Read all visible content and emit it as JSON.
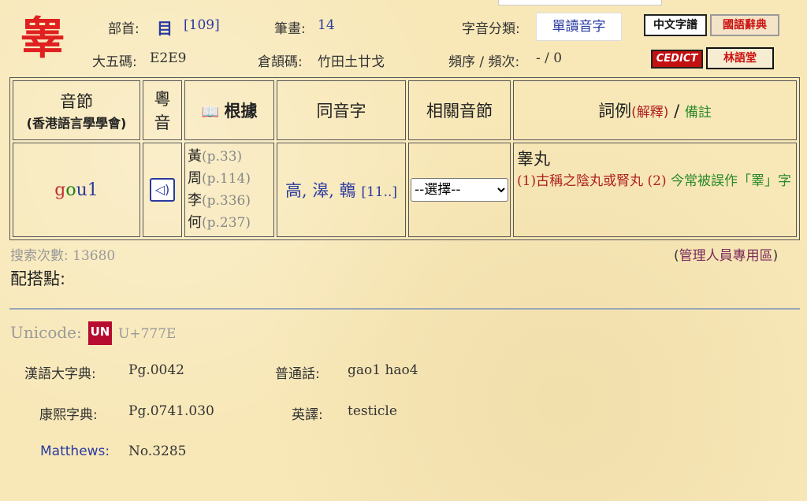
{
  "char": "睾",
  "header": {
    "radical_label": "部首:",
    "radical_icon": "目",
    "radical_num": "[109]",
    "strokes_label": "筆畫:",
    "strokes": "14",
    "class_label": "字音分類:",
    "class_value": "單讀音字",
    "big5_label": "大五碼:",
    "big5": "E2E9",
    "cangjie_label": "倉頡碼:",
    "cangjie": "竹田土廿戈",
    "freq_label": "頻序 / 頻次:",
    "freq": "- / 0",
    "logos": {
      "zhongwen": "中文字譜",
      "guoyu": "國語辭典",
      "cedict": "CEDICT",
      "linyutang": "林語堂"
    }
  },
  "table": {
    "headers": {
      "syllable": "音節",
      "syllable_sub": "(香港語言學學會)",
      "cantonese_1": "粵",
      "cantonese_2": "音",
      "basis_icon": "📖",
      "basis": "根據",
      "homophones": "同音字",
      "related": "相關音節",
      "examples": "詞例",
      "explain": "(解釋)",
      "slash": " / ",
      "notes": "備註"
    },
    "row": {
      "syllable_g": "g",
      "syllable_o": "o",
      "syllable_u1": "u1",
      "refs": [
        {
          "char": "黃",
          "page": "(p.33)"
        },
        {
          "char": "周",
          "page": "(p.114)"
        },
        {
          "char": "李",
          "page": "(p.336)"
        },
        {
          "char": "何",
          "page": "(p.237)"
        }
      ],
      "homophones": [
        "高",
        "滜",
        "鶾"
      ],
      "homophone_count": "[11..]",
      "related_select": "--選擇--",
      "example_word": "睾丸",
      "def1_num": "(1)",
      "def1": "古稱之陰丸或腎丸",
      "def2_num": "(2)",
      "def2": " 今常被誤作「睪」字"
    }
  },
  "search_count_label": "搜索次數: ",
  "search_count": "13680",
  "admin_open": "(",
  "admin_link": "管理人員專用區",
  "admin_close": ")",
  "collocation_label": "配搭點:",
  "unicode_label": "Unicode:",
  "unicode_logo": "UN",
  "unicode_value": "U+777E",
  "meta": {
    "hanyu_label": "漢語大字典:",
    "hanyu": "Pg.0042",
    "putonghua_label": "普通話:",
    "putonghua": "gao1 hao4",
    "kangxi_label": "康熙字典:",
    "kangxi": "Pg.0741.030",
    "english_label": "英譯:",
    "english": "testicle",
    "matthews_label": "Matthews:",
    "matthews": "No.3285"
  },
  "colors": {
    "accent_red": "#e02020",
    "link_blue": "#2a3aa0",
    "note_green": "#2a8a2a",
    "background": "#f8e8b8"
  }
}
